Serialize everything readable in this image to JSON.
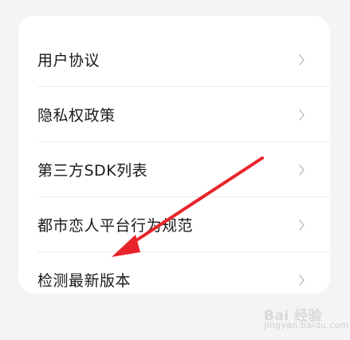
{
  "menu": {
    "items": [
      {
        "label": "用户协议",
        "icon": "chevron-right-icon"
      },
      {
        "label": "隐私权政策",
        "icon": "chevron-right-icon"
      },
      {
        "label": "第三方SDK列表",
        "icon": "chevron-right-icon"
      },
      {
        "label": "都市恋人平台行为规范",
        "icon": "chevron-right-icon"
      },
      {
        "label": "检测最新版本",
        "icon": "chevron-right-icon"
      }
    ]
  },
  "annotation": {
    "arrow_color": "#e8242a"
  },
  "watermark": {
    "text": "Bai 经验",
    "sub": "jingyan.baidu.com"
  }
}
